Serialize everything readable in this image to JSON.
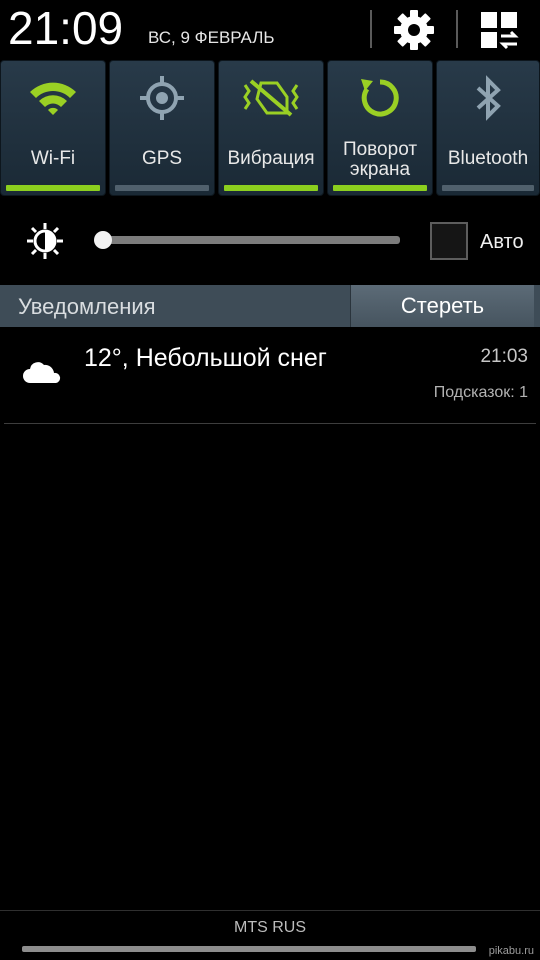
{
  "header": {
    "time": "21:09",
    "date": "ВС, 9 ФЕВРАЛЬ"
  },
  "toggles": [
    {
      "label": "Wi-Fi",
      "icon": "wifi-icon",
      "state": "on"
    },
    {
      "label": "GPS",
      "icon": "gps-icon",
      "state": "off"
    },
    {
      "label": "Вибрация",
      "icon": "vibrate-icon",
      "state": "on"
    },
    {
      "label": "Поворот экрана",
      "line1": "Поворот",
      "line2": "экрана",
      "icon": "rotate-icon",
      "state": "on"
    },
    {
      "label": "Bluetooth",
      "icon": "bluetooth-icon",
      "state": "off"
    }
  ],
  "brightness": {
    "level": 0.0,
    "auto_label": "Авто",
    "auto_checked": false
  },
  "notifications": {
    "title": "Уведомления",
    "clear_label": "Стереть",
    "items": [
      {
        "icon": "cloud-icon",
        "text": "12°, Небольшой снег",
        "time": "21:03",
        "hint": "Подсказок: 1"
      }
    ]
  },
  "footer": {
    "carrier": "MTS RUS",
    "watermark": "pikabu.ru"
  },
  "colors": {
    "accent_on": "#8ccf1e",
    "bar_off": "#50606c",
    "tile_bg": "#1f2f3c",
    "notif_header": "#3e4c57"
  }
}
